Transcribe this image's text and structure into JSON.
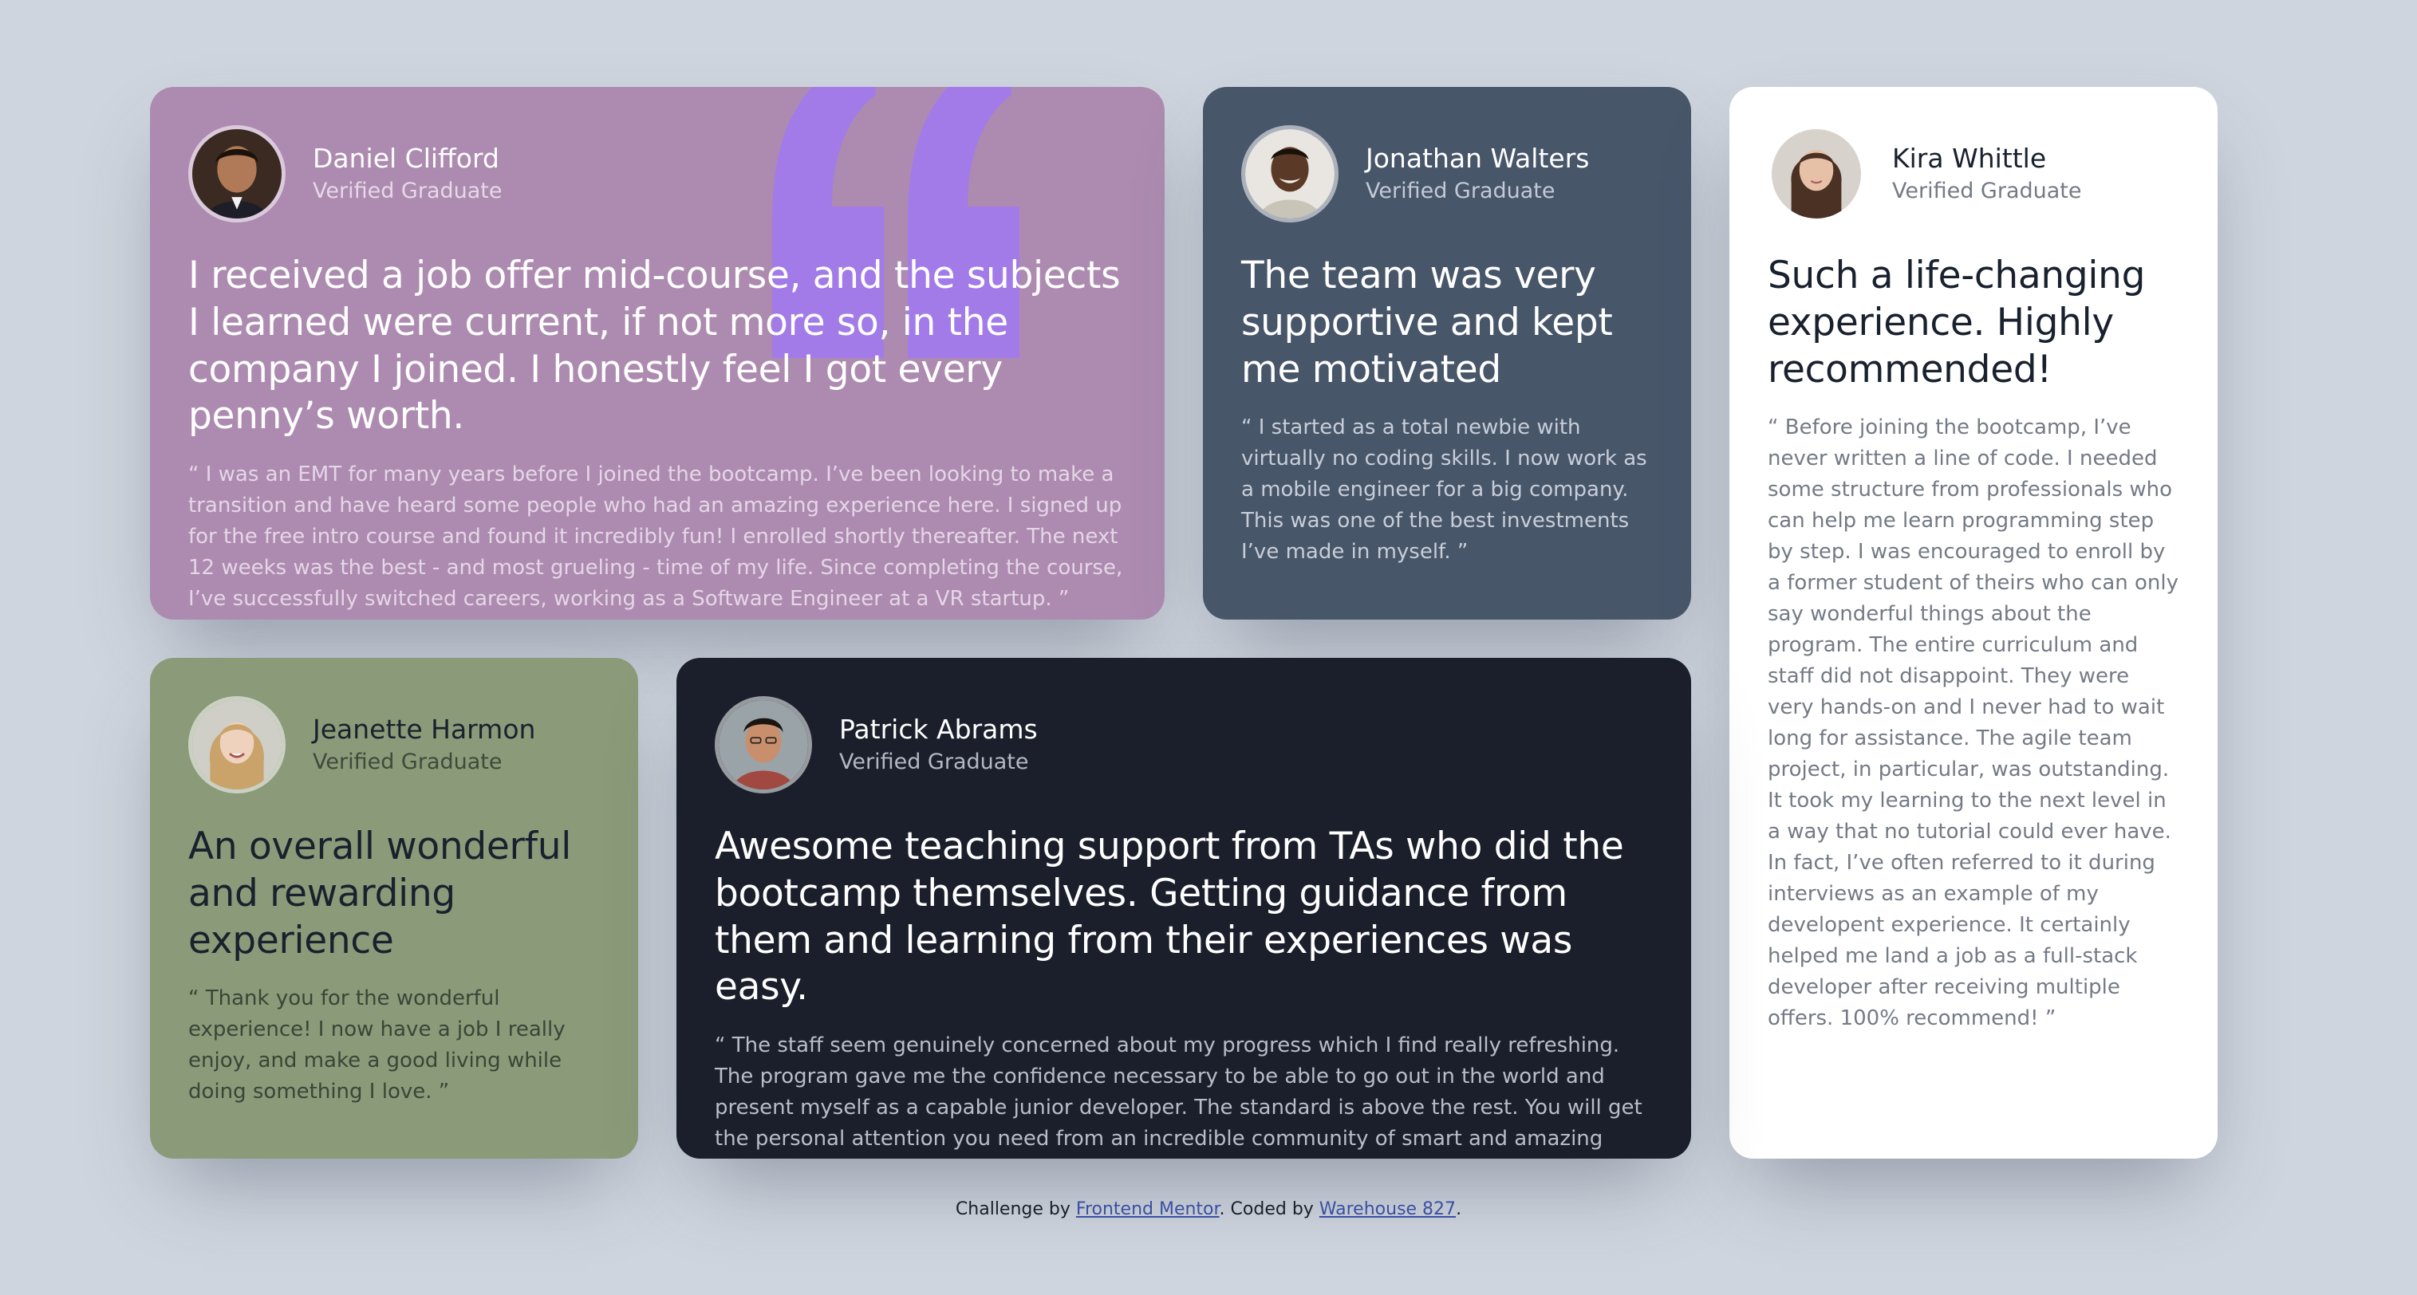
{
  "colors": {
    "background": "#cfd5de",
    "daniel_card": "#ad8bb0",
    "jonathan_card": "#48566a",
    "kira_card": "#ffffff",
    "jeanette_card": "#8b9a78",
    "patrick_card": "#1a1f2b",
    "quote_mark": "#a27be8",
    "link": "#3b4fa3"
  },
  "testimonials": {
    "daniel": {
      "name": "Daniel Clifford",
      "role": "Verified Graduate",
      "avatar_icon": "avatar-daniel-clifford",
      "headline": "I received a job offer mid-course, and the subjects I learned were current, if not more so, in the company I joined. I honestly feel I got every penny’s worth.",
      "body": "“ I was an EMT for many years before I joined the bootcamp. I’ve been looking to make a transition and have heard some people who had an amazing experience here. I signed up for the free intro course and found it incredibly fun! I enrolled shortly thereafter. The next 12 weeks was the best - and most grueling - time of my life. Since completing the course, I’ve successfully switched careers, working as a Software Engineer at a VR startup. ”"
    },
    "jonathan": {
      "name": "Jonathan Walters",
      "role": "Verified Graduate",
      "avatar_icon": "avatar-jonathan-walters",
      "headline": "The team was very supportive and kept me motivated",
      "body": "“ I started as a total newbie with virtually no coding skills. I now work as a mobile engineer for a big company. This was one of the best investments I’ve made in myself. ”"
    },
    "kira": {
      "name": "Kira Whittle",
      "role": "Verified Graduate",
      "avatar_icon": "avatar-kira-whittle",
      "headline": "Such a life-changing experience. Highly recommended!",
      "body": "“ Before joining the bootcamp, I’ve never written a line of code. I needed some structure from professionals who can help me learn programming step by step. I was encouraged to enroll by a former student of theirs who can only say wonderful things about the program. The entire curriculum and staff did not disappoint. They were very hands-on and I never had to wait long for assistance. The agile team project, in particular, was outstanding. It took my learning to the next level in a way that no tutorial could ever have. In fact, I’ve often referred to it during interviews as an example of my developent experience. It certainly helped me land a job as a full-stack developer after receiving multiple offers. 100% recommend! ”"
    },
    "jeanette": {
      "name": "Jeanette Harmon",
      "role": "Verified Graduate",
      "avatar_icon": "avatar-jeanette-harmon",
      "headline": "An overall wonderful and rewarding experience",
      "body": "“ Thank you for the wonderful experience! I now have a job I really enjoy, and make a good living while doing something I love. ”"
    },
    "patrick": {
      "name": "Patrick Abrams",
      "role": "Verified Graduate",
      "avatar_icon": "avatar-patrick-abrams",
      "headline": "Awesome teaching support from TAs who did the bootcamp themselves. Getting guidance from them and learning from their experiences was easy.",
      "body": "“ The staff seem genuinely concerned about my progress which I find really refreshing. The program gave me the confidence necessary to be able to go out in the world and present myself as a capable junior developer. The standard is above the rest. You will get the personal attention you need from an incredible community of smart and amazing people. ”"
    }
  },
  "attribution": {
    "prefix": "Challenge by ",
    "frontend_mentor": "Frontend Mentor",
    "middle": ". Coded by ",
    "author": "Warehouse 827",
    "suffix": "."
  }
}
